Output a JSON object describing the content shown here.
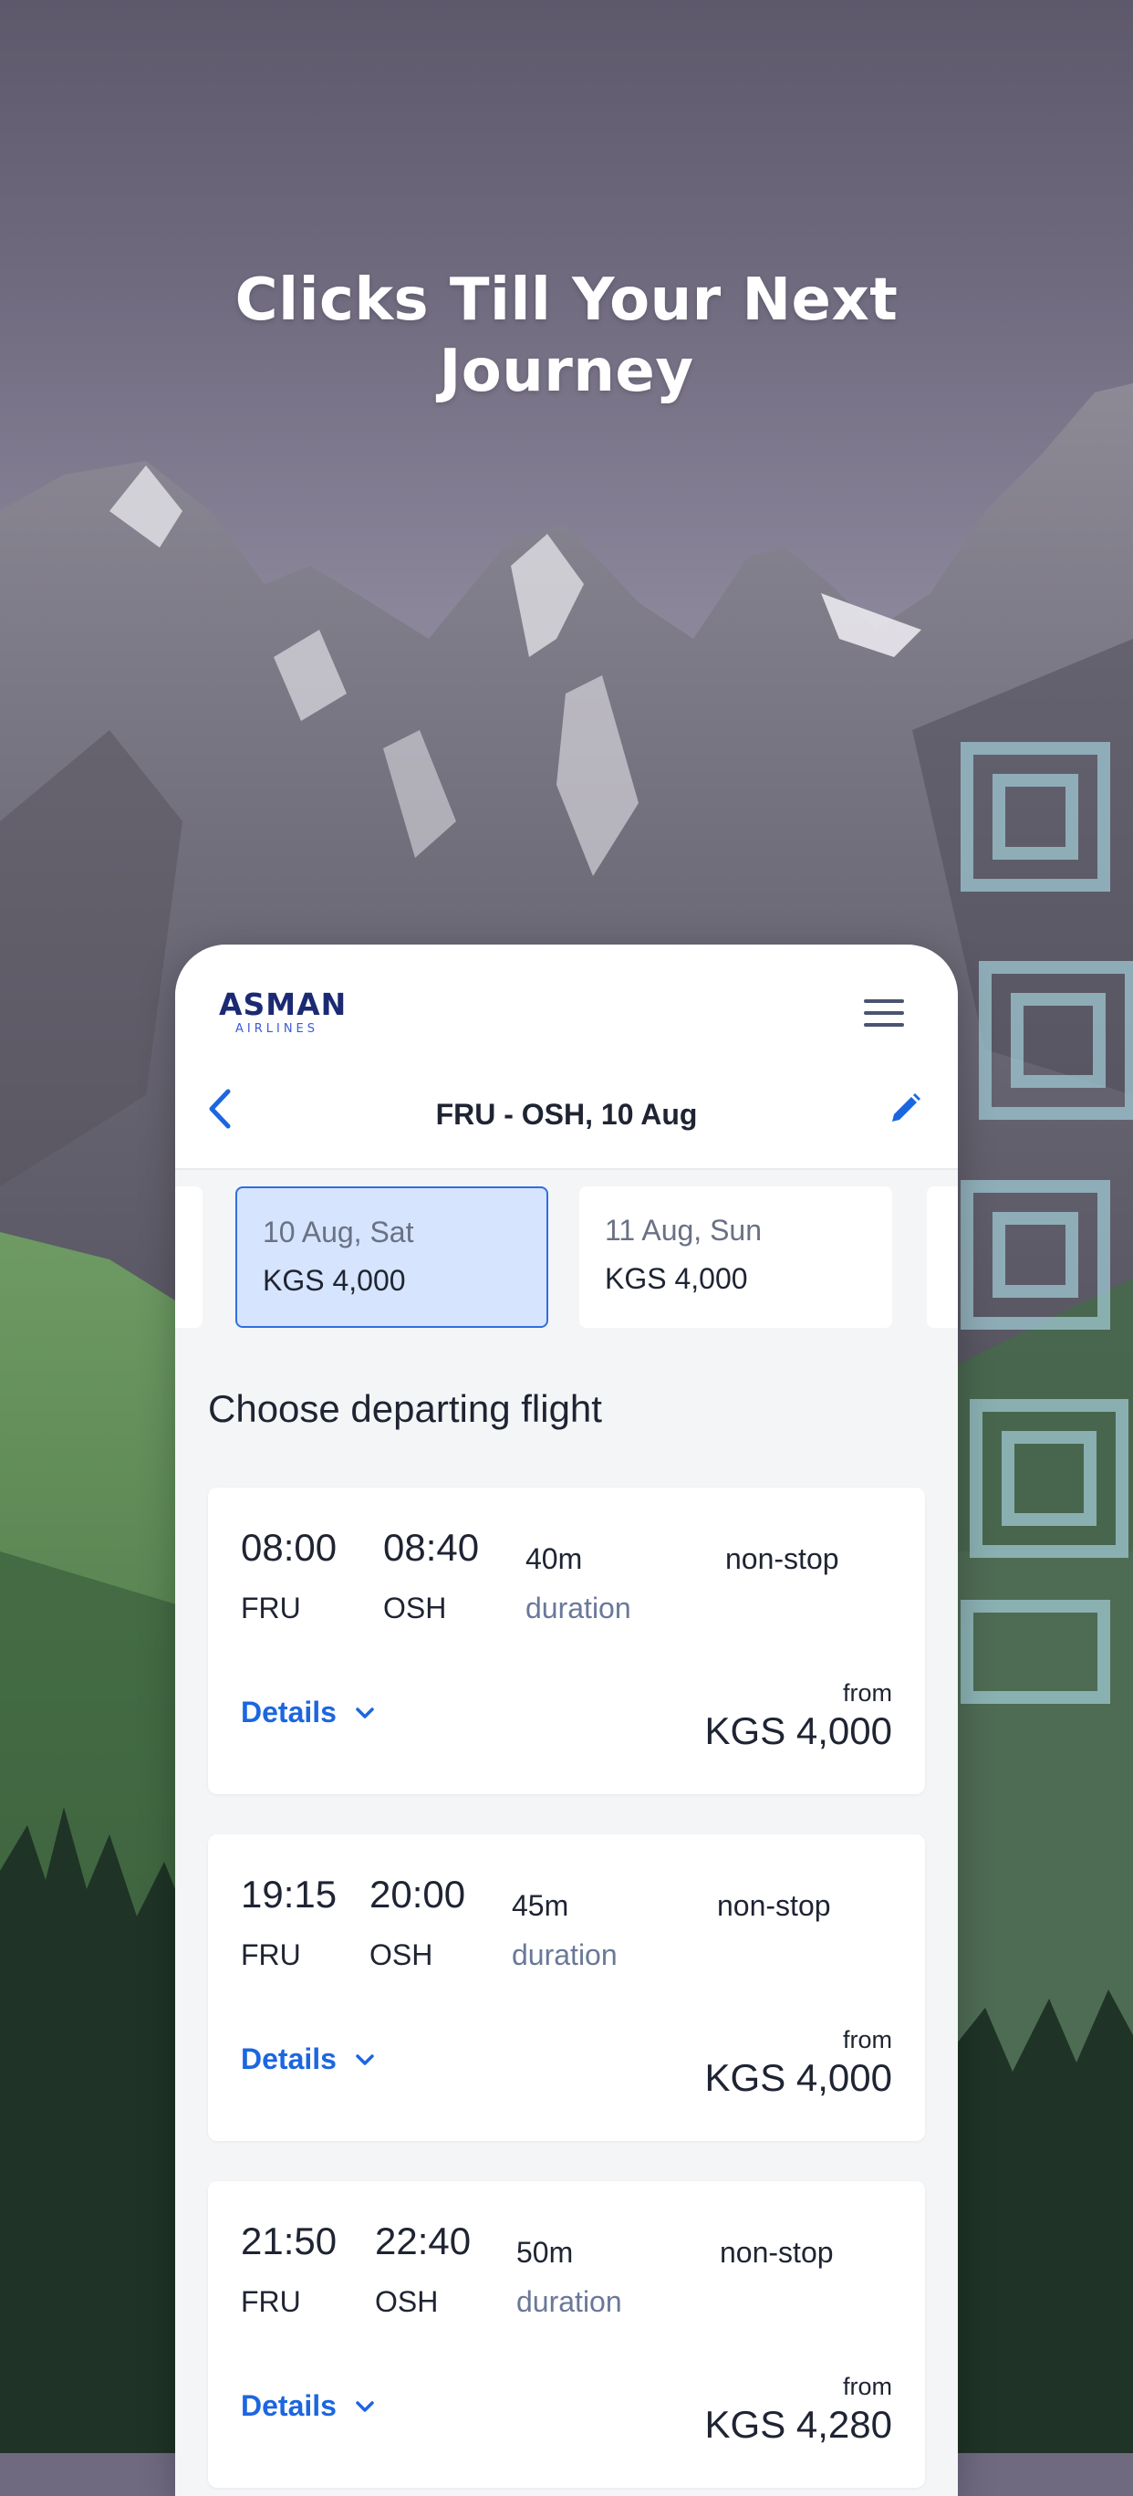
{
  "promo": {
    "headline_line1": "Clicks Till Your Next",
    "headline_line2": "Journey"
  },
  "header": {
    "logo_main": "ASMAN",
    "logo_sub": "AIRLINES",
    "route_title": "FRU - OSH, 10 Aug"
  },
  "date_strip": [
    {
      "date": "10 Aug, Sat",
      "price": "KGS 4,000",
      "selected": true
    },
    {
      "date": "11 Aug, Sun",
      "price": "KGS 4,000",
      "selected": false
    }
  ],
  "section_title": "Choose departing flight",
  "flights": [
    {
      "depart_time": "08:00",
      "arrive_time": "08:40",
      "from_code": "FRU",
      "to_code": "OSH",
      "duration": "40m",
      "duration_label": "duration",
      "stops": "non-stop",
      "details_label": "Details",
      "from_label": "from",
      "price": "KGS 4,000"
    },
    {
      "depart_time": "19:15",
      "arrive_time": "20:00",
      "from_code": "FRU",
      "to_code": "OSH",
      "duration": "45m",
      "duration_label": "duration",
      "stops": "non-stop",
      "details_label": "Details",
      "from_label": "from",
      "price": "KGS 4,000"
    },
    {
      "depart_time": "21:50",
      "arrive_time": "22:40",
      "from_code": "FRU",
      "to_code": "OSH",
      "duration": "50m",
      "duration_label": "duration",
      "stops": "non-stop",
      "details_label": "Details",
      "from_label": "from",
      "price": "KGS 4,280"
    }
  ],
  "icons": {
    "menu": "hamburger-menu-icon",
    "back": "chevron-left-icon",
    "edit": "pencil-icon",
    "expand": "chevron-down-icon"
  },
  "colors": {
    "accent": "#1c66e0",
    "selected_chip_bg": "#d6e4fd",
    "brand_navy": "#1b2a72",
    "text_primary": "#1f2433",
    "text_secondary": "#6a7898"
  }
}
